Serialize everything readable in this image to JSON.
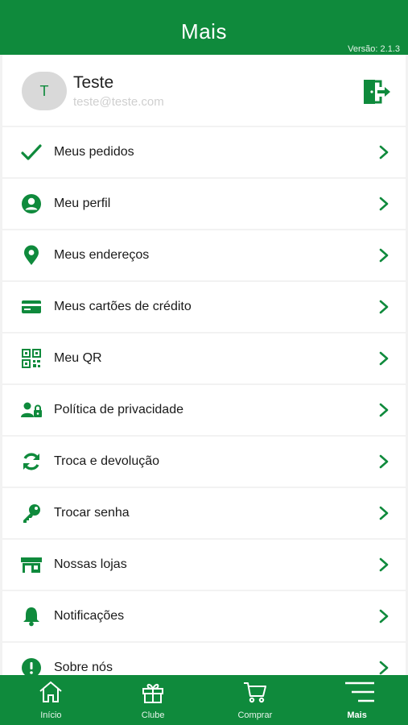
{
  "header": {
    "title": "Mais",
    "version": "Versão: 2.1.3"
  },
  "profile": {
    "avatar_letter": "T",
    "name": "Teste",
    "email": "teste@teste.com",
    "logout_icon": "logout-icon"
  },
  "menu": {
    "items": [
      {
        "label": "Meus pedidos",
        "icon": "check-icon"
      },
      {
        "label": "Meu perfil",
        "icon": "user-circle-icon"
      },
      {
        "label": "Meus endereços",
        "icon": "location-pin-icon"
      },
      {
        "label": "Meus cartões de crédito",
        "icon": "credit-card-icon"
      },
      {
        "label": "Meu QR",
        "icon": "qr-code-icon"
      },
      {
        "label": "Política de privacidade",
        "icon": "user-lock-icon"
      },
      {
        "label": "Troca e devolução",
        "icon": "refresh-icon"
      },
      {
        "label": "Trocar senha",
        "icon": "key-icon"
      },
      {
        "label": "Nossas lojas",
        "icon": "store-icon"
      },
      {
        "label": "Notificações",
        "icon": "bell-icon"
      },
      {
        "label": "Sobre nós",
        "icon": "info-icon"
      }
    ]
  },
  "tabbar": {
    "tabs": [
      {
        "label": "Início",
        "icon": "home-icon"
      },
      {
        "label": "Clube",
        "icon": "gift-icon"
      },
      {
        "label": "Comprar",
        "icon": "cart-icon"
      },
      {
        "label": "Mais",
        "icon": "menu-icon",
        "active": true
      }
    ]
  },
  "colors": {
    "brand": "#0f8a3c",
    "background": "#f2f2f2"
  }
}
